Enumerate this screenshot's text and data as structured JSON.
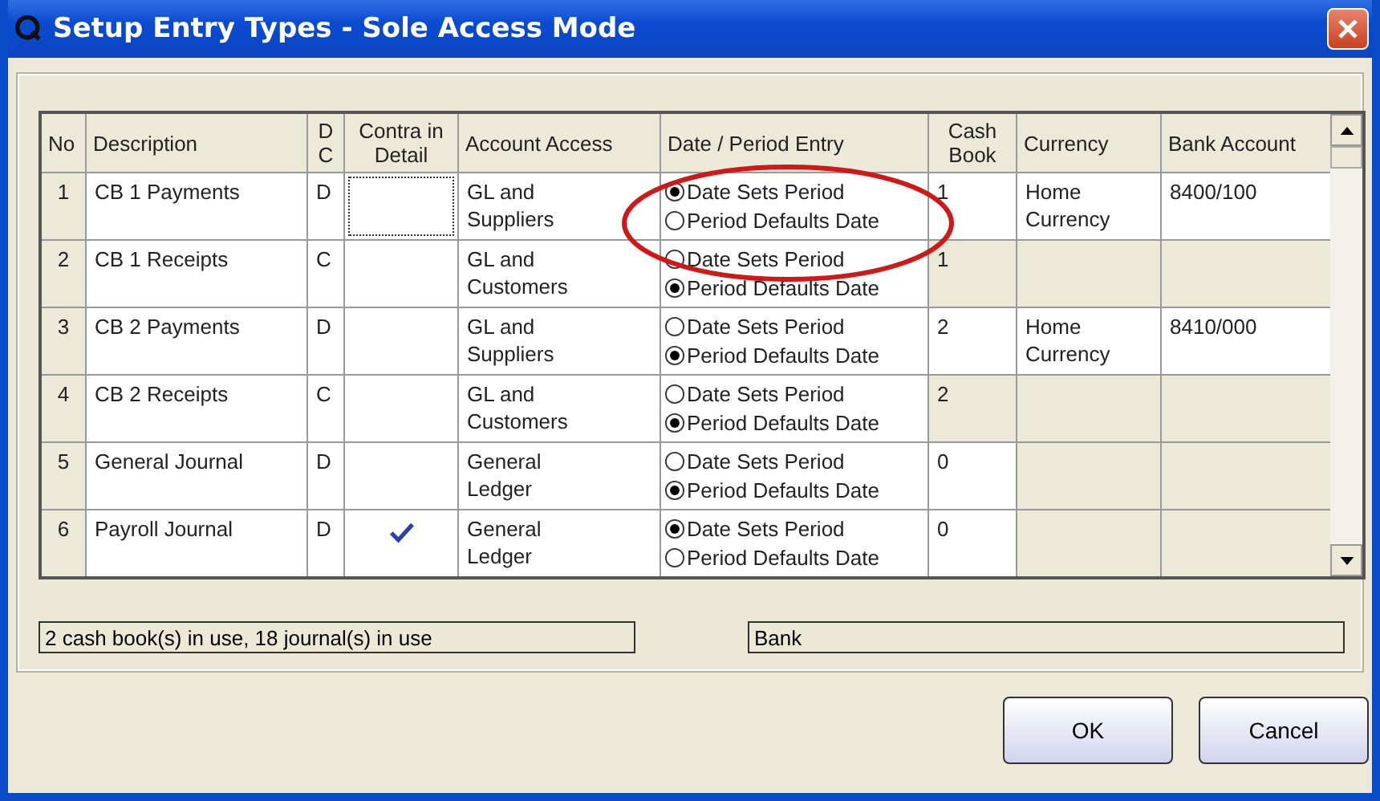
{
  "window": {
    "title": "Setup Entry Types - Sole Access Mode"
  },
  "table": {
    "columns": [
      "No",
      "Description",
      "D\nC",
      "Contra in\nDetail",
      "Account Access",
      "Date / Period Entry",
      "Cash\nBook",
      "Currency",
      "Bank Account"
    ],
    "rows": [
      {
        "no": "1",
        "description": "CB 1 Payments",
        "dc": "D",
        "contra": false,
        "focused": true,
        "account_access": "GL and\nSuppliers",
        "date_options": [
          {
            "label": "Date Sets Period",
            "selected": true
          },
          {
            "label": "Period Defaults Date",
            "selected": false
          }
        ],
        "cash_book": "1",
        "cash_book_editable": true,
        "currency": "Home\nCurrency",
        "bank_account": "8400/100",
        "bank_editable": true
      },
      {
        "no": "2",
        "description": "CB 1 Receipts",
        "dc": "C",
        "contra": false,
        "focused": false,
        "account_access": "GL and\nCustomers",
        "date_options": [
          {
            "label": "Date Sets Period",
            "selected": false
          },
          {
            "label": "Period Defaults Date",
            "selected": true
          }
        ],
        "cash_book": "1",
        "cash_book_editable": false,
        "bank_editable": false
      },
      {
        "no": "3",
        "description": "CB 2 Payments",
        "dc": "D",
        "contra": false,
        "focused": false,
        "account_access": "GL and\nSuppliers",
        "date_options": [
          {
            "label": "Date Sets Period",
            "selected": false
          },
          {
            "label": "Period Defaults Date",
            "selected": true
          }
        ],
        "cash_book": "2",
        "cash_book_editable": true,
        "currency": "Home\nCurrency",
        "bank_account": "8410/000",
        "bank_editable": true
      },
      {
        "no": "4",
        "description": "CB 2 Receipts",
        "dc": "C",
        "contra": false,
        "focused": false,
        "account_access": "GL and\nCustomers",
        "date_options": [
          {
            "label": "Date Sets Period",
            "selected": false
          },
          {
            "label": "Period Defaults Date",
            "selected": true
          }
        ],
        "cash_book": "2",
        "cash_book_editable": false,
        "bank_editable": false
      },
      {
        "no": "5",
        "description": "General Journal",
        "dc": "D",
        "contra": false,
        "focused": false,
        "account_access": "General\nLedger",
        "date_options": [
          {
            "label": "Date Sets Period",
            "selected": false
          },
          {
            "label": "Period Defaults Date",
            "selected": true
          }
        ],
        "cash_book": "0",
        "cash_book_editable": true,
        "bank_editable": false
      },
      {
        "no": "6",
        "description": "Payroll Journal",
        "dc": "D",
        "contra": true,
        "focused": false,
        "account_access": "General\nLedger",
        "date_options": [
          {
            "label": "Date Sets Period",
            "selected": true
          },
          {
            "label": "Period Defaults Date",
            "selected": false
          }
        ],
        "cash_book": "0",
        "cash_book_editable": true,
        "bank_editable": false
      }
    ]
  },
  "status_bar": [
    "2 cash book(s) in use,  18 journal(s) in use",
    "Bank"
  ],
  "buttons": [
    "OK",
    "Cancel"
  ]
}
